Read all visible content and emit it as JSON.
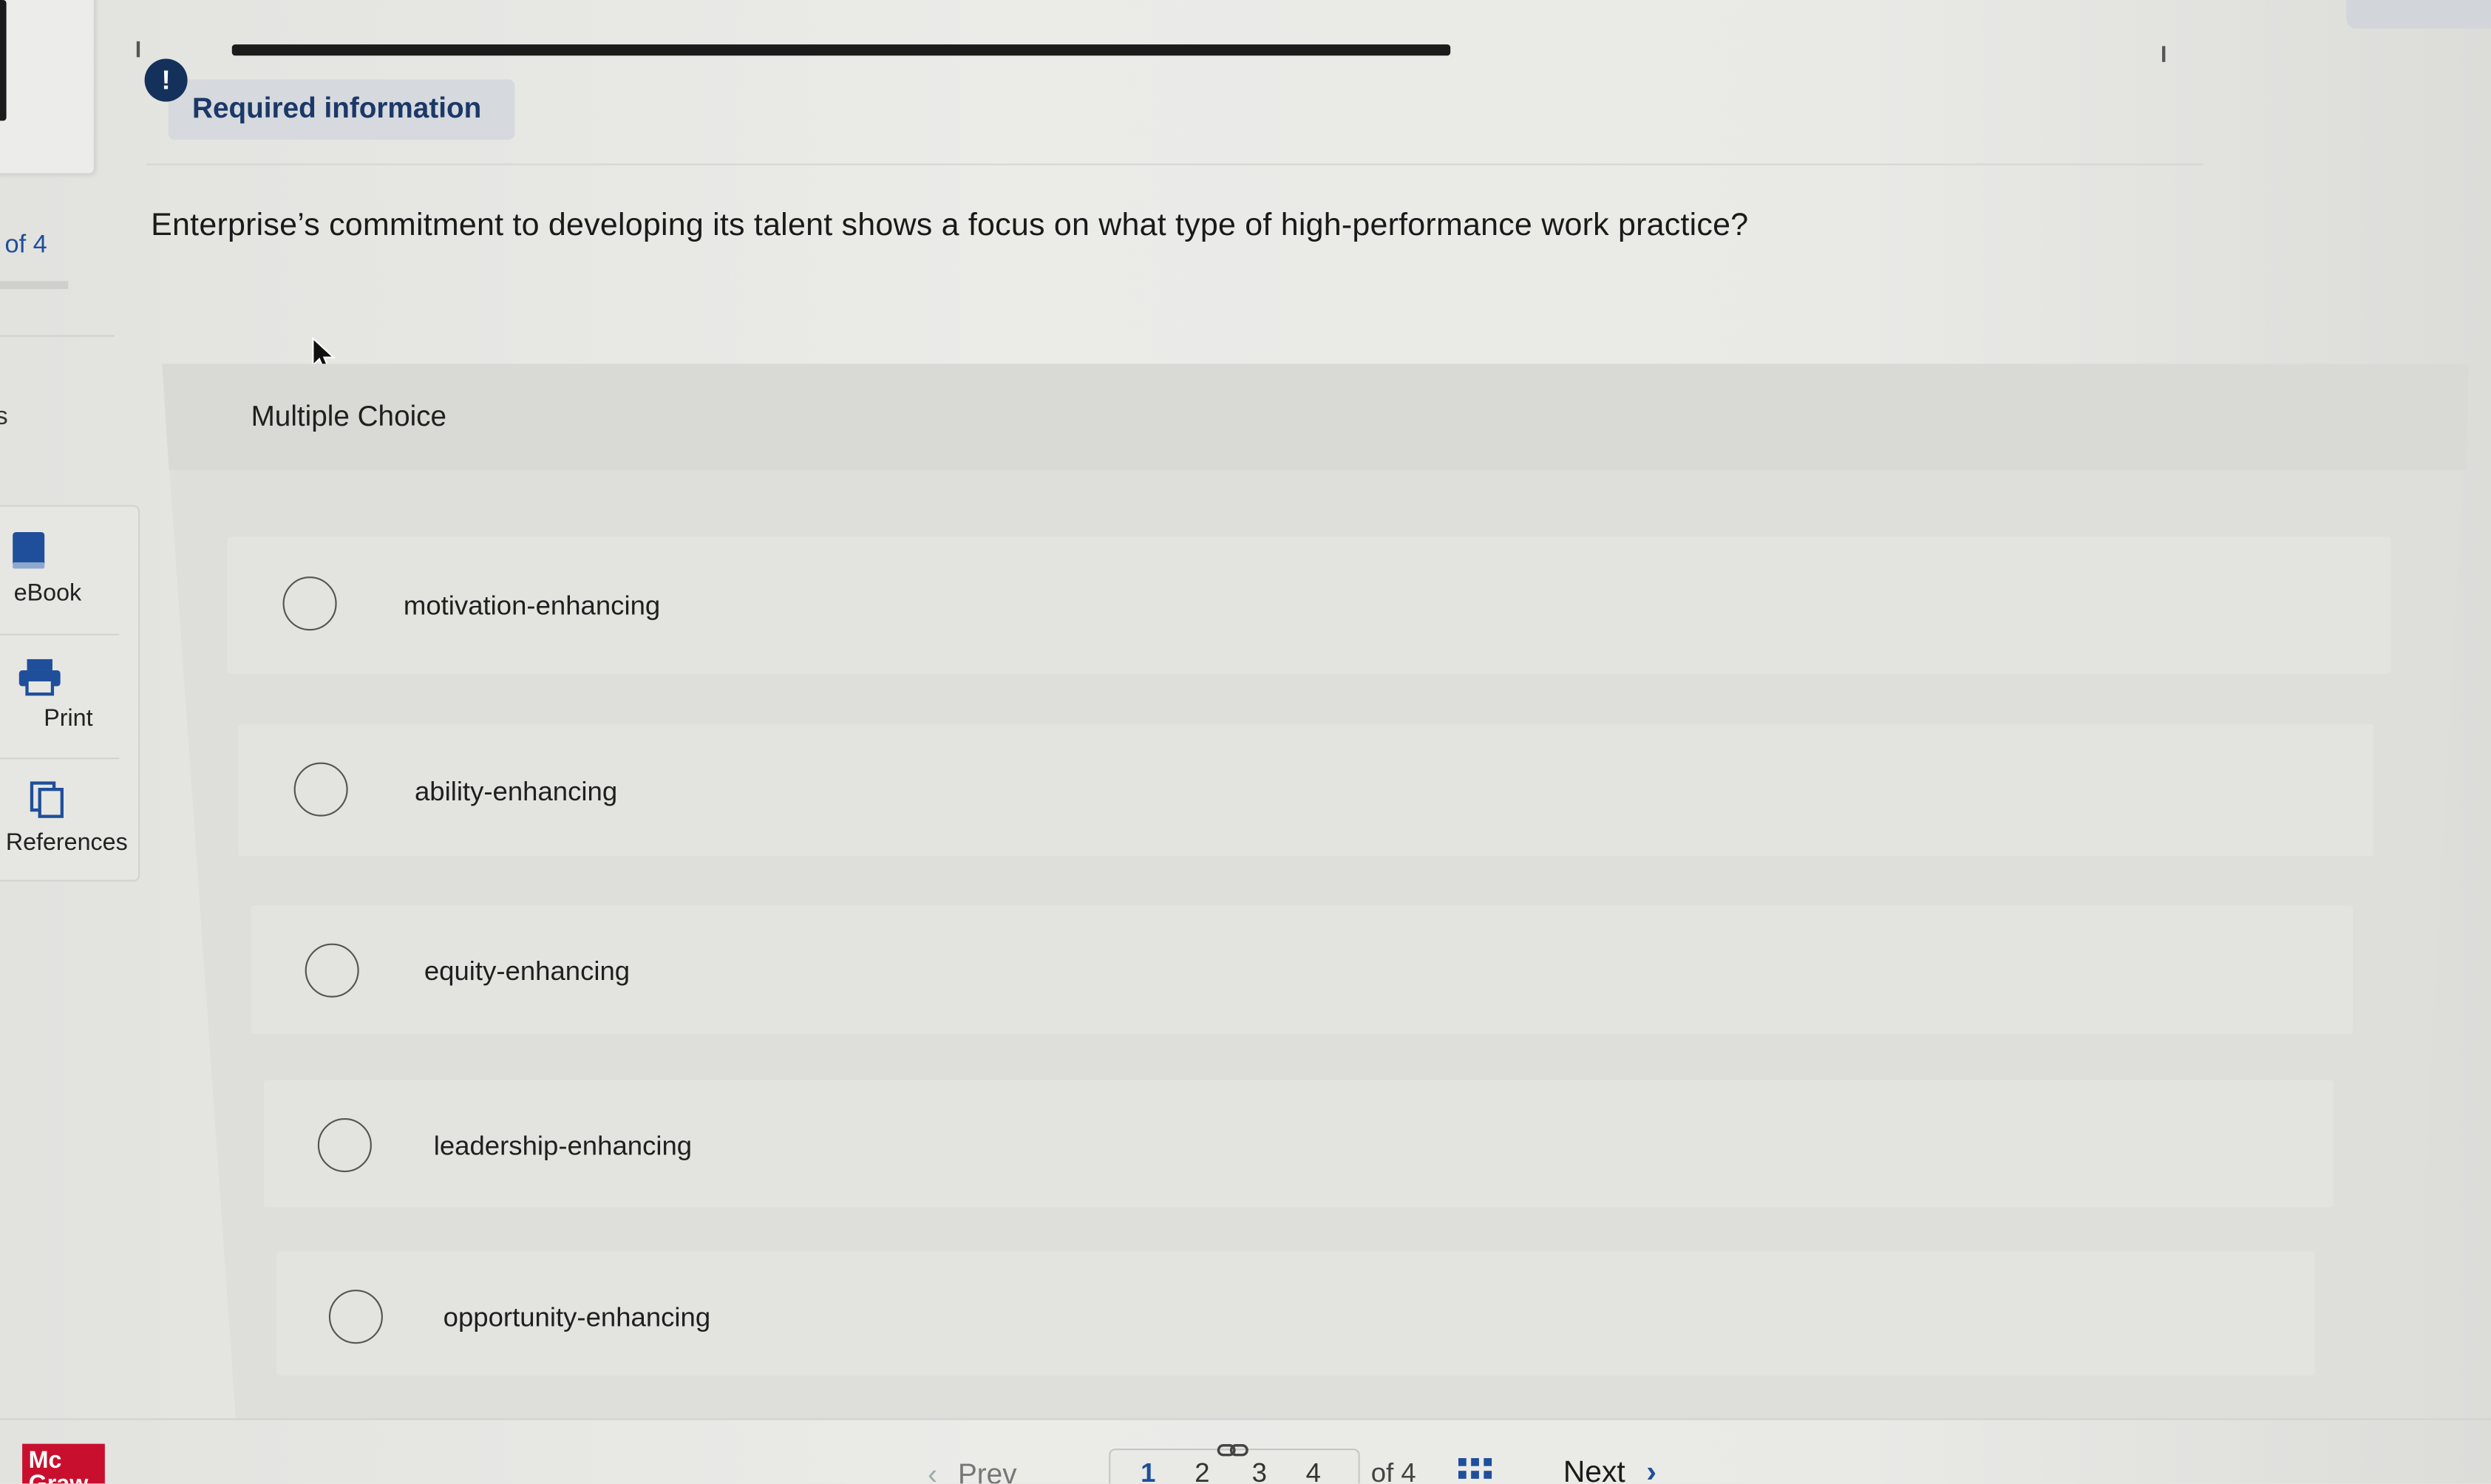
{
  "sidebar": {
    "progress_text": "of 4",
    "partial_char": "s",
    "tools": [
      {
        "label": "eBook",
        "icon": "book-icon"
      },
      {
        "label": "Print",
        "icon": "printer-icon"
      },
      {
        "label": "References",
        "icon": "references-icon"
      }
    ],
    "logo_text": "Mc\nGraw"
  },
  "header": {
    "badge_icon": "!",
    "badge_text": "Required information"
  },
  "question": {
    "text": "Enterprise’s commitment to developing its talent shows a focus on what type of high-performance work practice?"
  },
  "multiple_choice": {
    "title": "Multiple Choice",
    "options": [
      {
        "label": "motivation-enhancing",
        "selected": false
      },
      {
        "label": "ability-enhancing",
        "selected": false
      },
      {
        "label": "equity-enhancing",
        "selected": false
      },
      {
        "label": "leadership-enhancing",
        "selected": false
      },
      {
        "label": "opportunity-enhancing",
        "selected": false
      }
    ]
  },
  "navigation": {
    "prev_label": "Prev",
    "pages": [
      "1",
      "2",
      "3",
      "4"
    ],
    "current_page": "1",
    "of_label": "of 4",
    "next_label": "Next"
  },
  "colors": {
    "accent_blue": "#1f4f9a",
    "badge_navy": "#14315c",
    "brand_red": "#c8102e"
  }
}
